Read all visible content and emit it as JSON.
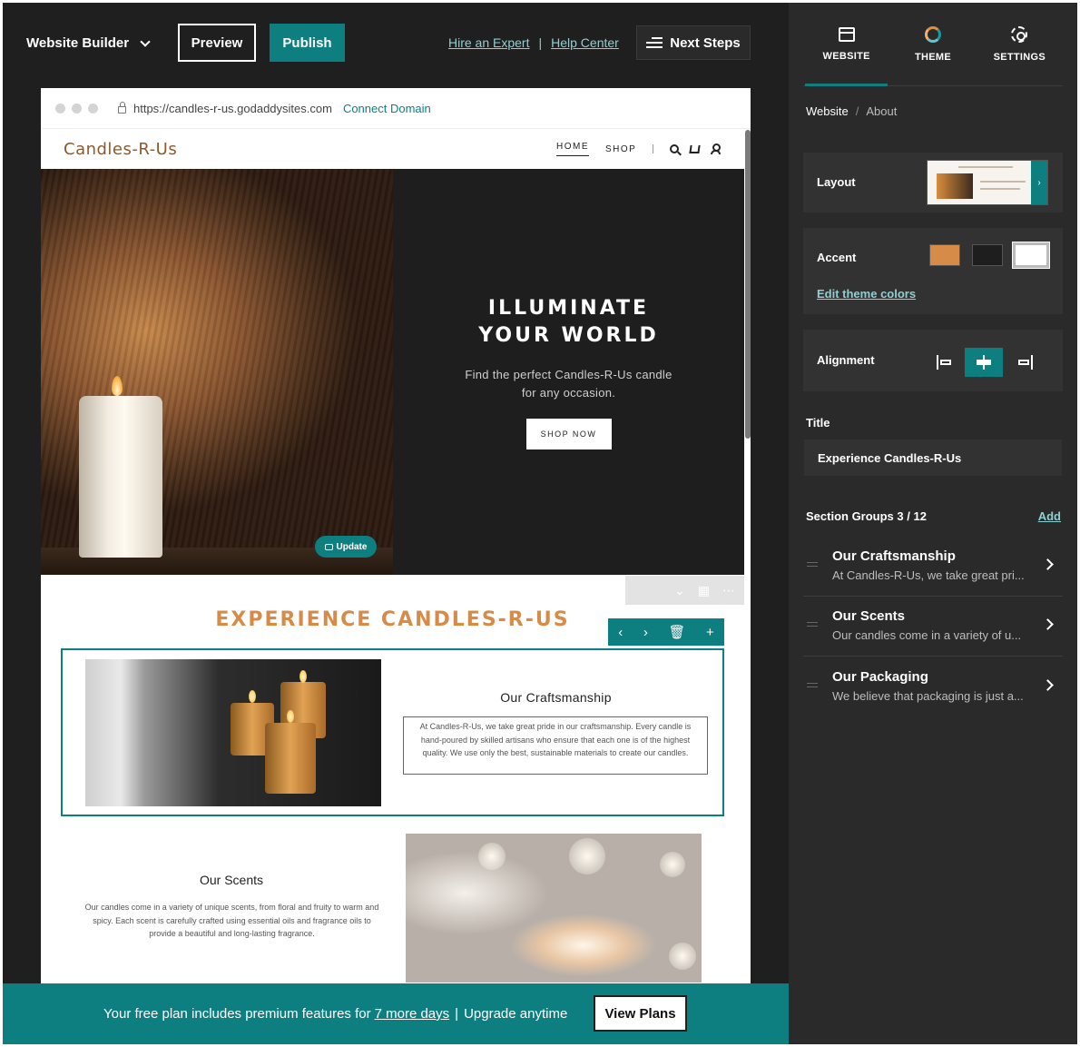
{
  "toolbar": {
    "brand": "Website Builder",
    "preview": "Preview",
    "publish": "Publish",
    "hire_expert": "Hire an Expert",
    "link_sep": "|",
    "help_center": "Help Center",
    "next_steps": "Next Steps"
  },
  "browser": {
    "url": "https://candles-r-us.godaddysites.com",
    "connect_domain": "Connect Domain"
  },
  "site": {
    "logo": "Candles-R-Us",
    "nav": {
      "home": "HOME",
      "shop": "SHOP"
    },
    "hero": {
      "title": "ILLUMINATE\nYOUR WORLD",
      "subtitle": "Find the perfect Candles-R-Us candle for any occasion.",
      "cta": "SHOP NOW",
      "update": "Update"
    },
    "section": {
      "title": "EXPERIENCE CANDLES-R-US",
      "craft_heading": "Our Craftsmanship",
      "craft_text": "At Candles-R-Us, we take great pride in our craftsmanship. Every candle is hand-poured by skilled artisans who ensure that each one is of the highest quality. We use only the best, sustainable materials to create our candles.",
      "scents_heading": "Our Scents",
      "scents_text": "Our candles come in a variety of unique scents, from floral and fruity to warm and spicy. Each scent is carefully crafted using essential oils and fragrance oils to provide a beautiful and long-lasting fragrance."
    }
  },
  "promo": {
    "text_before": "Your free plan includes premium features for",
    "days_link": "7 more days",
    "sep": "|",
    "text_after": "Upgrade anytime",
    "view_plans": "View Plans"
  },
  "panel": {
    "tabs": [
      {
        "label": "WEBSITE",
        "icon": "window-icon"
      },
      {
        "label": "THEME",
        "icon": "theme-icon"
      },
      {
        "label": "SETTINGS",
        "icon": "gear-icon"
      }
    ],
    "breadcrumb": {
      "root": "Website",
      "sep": "/",
      "current": "About"
    },
    "layout_label": "Layout",
    "accent_label": "Accent",
    "accent_colors": [
      "#d68c48",
      "#1e1e1f",
      "#ffffff"
    ],
    "edit_theme_colors": "Edit theme colors",
    "alignment_label": "Alignment",
    "title_label": "Title",
    "title_value": "Experience Candles-R-Us",
    "section_groups_label": "Section Groups 3 / 12",
    "add": "Add",
    "groups": [
      {
        "name": "Our Craftsmanship",
        "desc": "At Candles-R-Us, we take great pri..."
      },
      {
        "name": "Our Scents",
        "desc": "Our candles come in a variety of u..."
      },
      {
        "name": "Our Packaging",
        "desc": "We believe that packaging is just a..."
      }
    ]
  },
  "colors": {
    "teal": "#0e7f80",
    "accent": "#d68c48",
    "dark": "#1f1f1f"
  }
}
